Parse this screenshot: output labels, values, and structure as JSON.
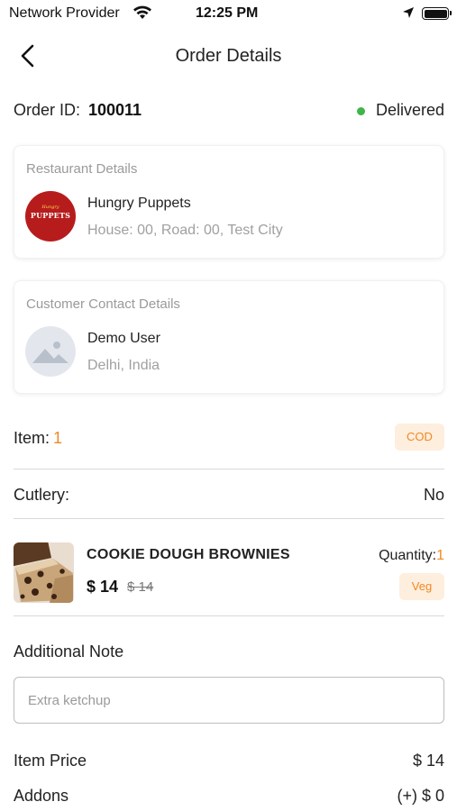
{
  "status_bar": {
    "carrier": "Network Provider",
    "time": "12:25 PM"
  },
  "header": {
    "title": "Order Details"
  },
  "order": {
    "id_label": "Order ID:",
    "id": "100011",
    "status": "Delivered",
    "status_color": "#3fb54a"
  },
  "restaurant": {
    "section_title": "Restaurant Details",
    "name": "Hungry Puppets",
    "address": "House: 00, Road: 00, Test City",
    "logo_text": "PUPPETS",
    "logo_small_text": "Hungry",
    "logo_color": "#b71c1c"
  },
  "customer": {
    "section_title": "Customer Contact Details",
    "name": "Demo User",
    "location": "Delhi, India",
    "avatar_icon": "image-placeholder-icon"
  },
  "items": {
    "label": "Item:",
    "count": "1",
    "payment_badge": "COD"
  },
  "cutlery": {
    "label": "Cutlery:",
    "value": "No"
  },
  "product": {
    "name": "COOKIE DOUGH BROWNIES",
    "price": "$ 14",
    "old_price": "$ 14",
    "quantity_label": "Quantity:",
    "quantity": "1",
    "type_badge": "Veg"
  },
  "note": {
    "label": "Additional Note",
    "placeholder": "Extra ketchup"
  },
  "pricing": {
    "item_price_label": "Item Price",
    "item_price": "$ 14",
    "addons_label": "Addons",
    "addons": "(+) $ 0"
  },
  "colors": {
    "accent": "#f08a24",
    "badge_bg": "#fdeede"
  }
}
